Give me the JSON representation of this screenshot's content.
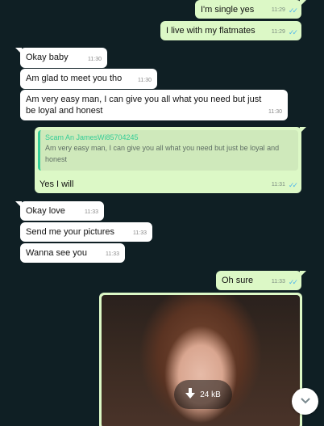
{
  "messages": [
    {
      "text": "I'm single yes",
      "time": "11:29"
    },
    {
      "text": "I live with my flatmates",
      "time": "11:29"
    },
    {
      "text": "Okay baby",
      "time": "11:30"
    },
    {
      "text": "Am glad to meet you tho",
      "time": "11:30"
    },
    {
      "text": "Am very easy man, I can give you all what you need but just be loyal and honest",
      "time": "11:30"
    },
    {
      "text": "Yes I will",
      "time": "11:31"
    },
    {
      "text": "Okay love",
      "time": "11:33"
    },
    {
      "text": "Send me your pictures",
      "time": "11:33"
    },
    {
      "text": "Wanna see you",
      "time": "11:33"
    },
    {
      "text": "Oh sure",
      "time": "11:33"
    }
  ],
  "quote": {
    "author": "Scam An JamesWi85704245",
    "text": "Am very easy man, I can give you all what you need but just be loyal and honest"
  },
  "image": {
    "size": "24 kB"
  },
  "icons": {
    "read_receipt": "double-check-icon",
    "download": "download-icon",
    "scroll": "chevron-down-icon"
  },
  "colors": {
    "background": "#0f1f24",
    "incoming": "#ffffff",
    "outgoing": "#dcf8c6",
    "ticks": "#4fb6ec",
    "quote_accent": "#35cd96"
  }
}
